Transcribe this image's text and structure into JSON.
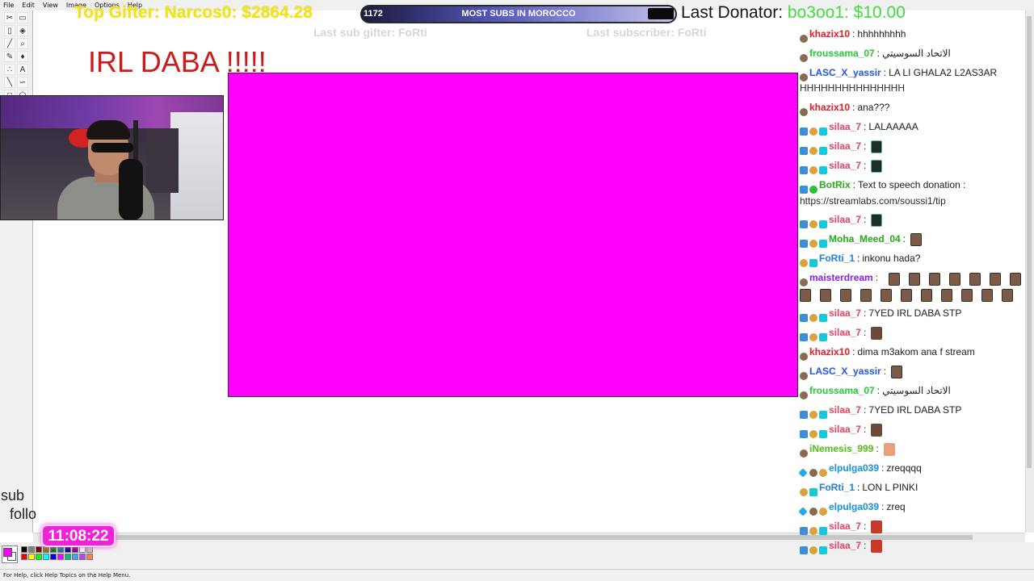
{
  "menu": {
    "items": [
      "File",
      "Edit",
      "View",
      "Image",
      "Options",
      "Help"
    ]
  },
  "overlay": {
    "top_gifter": "Top Gifter: Narcos0: $2864.28",
    "goal": {
      "count": "1172",
      "title": "MOST SUBS IN MOROCCO"
    },
    "last_donator_label": "Last Donator:",
    "last_donator_value": "bo3oo1: $10.00",
    "faded_left": "Last sub gifter: FoRti",
    "faded_right": "Last subscriber: FoRti",
    "title": "IRL DABA !!!!!",
    "sub_text": "sub",
    "follow_text": "follo",
    "clock": "11:08:22"
  },
  "colors": {
    "highlight": "#ff00ff",
    "title_red": "#cc1b1b",
    "gifter_yellow": "#f2e60a",
    "donator_green": "#3fdc3f",
    "clock_pink": "#ef22d8"
  },
  "palette": [
    "#000000",
    "#808080",
    "#800000",
    "#808000",
    "#008000",
    "#008080",
    "#000080",
    "#800080",
    "#ffffff",
    "#c0c0c0",
    "#ff0000",
    "#ffff00",
    "#00ff00",
    "#00ffff",
    "#0000ff",
    "#ff00ff",
    "#00c080",
    "#40a0ff",
    "#c040ff",
    "#ff8040"
  ],
  "chat": {
    "messages": [
      {
        "user": "khazix10",
        "color": "#e0242f",
        "text": "hhhhhhhhh",
        "badges": [
          "face"
        ]
      },
      {
        "user": "froussama_07",
        "color": "#2ecc40",
        "text": "الاتحاد السوسيتي",
        "badges": [
          "face"
        ]
      },
      {
        "user": "LASC_X_yassir",
        "color": "#2f5cd8",
        "text": "LA LI GHALA2 L2AS3AR",
        "badges": [
          "face"
        ]
      },
      {
        "user": "khazix10",
        "color": "#e0242f",
        "text": "ana???",
        "badges": [
          "face"
        ]
      },
      {
        "user": "silaa_7",
        "color": "#e34c6a",
        "text": "LALAAAAA",
        "badges": [
          "blue",
          "gold",
          "cyan"
        ]
      },
      {
        "user": "silaa_7",
        "color": "#e34c6a",
        "text": "",
        "badges": [
          "blue",
          "gold",
          "cyan"
        ],
        "emote": "dark"
      },
      {
        "user": "silaa_7",
        "color": "#e34c6a",
        "text": "",
        "badges": [
          "blue",
          "gold",
          "cyan"
        ],
        "emote": "dark"
      },
      {
        "user": "BotRix",
        "color": "#2fae20",
        "text": "Text to speech donation :",
        "badges": [
          "blue",
          "green"
        ]
      },
      {
        "user": "silaa_7",
        "color": "#e34c6a",
        "text": "",
        "badges": [
          "blue",
          "gold",
          "cyan"
        ],
        "emote": "dark"
      },
      {
        "user": "Moha_Meed_04",
        "color": "#2fae20",
        "text": "",
        "badges": [
          "blue",
          "gold",
          "cyan"
        ],
        "emote": "face"
      },
      {
        "user": "FoRti_1",
        "color": "#2b86d8",
        "text": "inkonu hada?",
        "badges": [
          "gold",
          "cyan"
        ]
      },
      {
        "user": "maisterdream",
        "color": "#8a2be2",
        "text": "",
        "badges": [
          "face"
        ]
      },
      {
        "user": "silaa_7",
        "color": "#e34c6a",
        "text": "7YED IRL DABA STP",
        "badges": [
          "blue",
          "gold",
          "cyan"
        ]
      },
      {
        "user": "silaa_7",
        "color": "#e34c6a",
        "text": "",
        "badges": [
          "blue",
          "gold",
          "cyan"
        ],
        "emote": "brown"
      },
      {
        "user": "khazix10",
        "color": "#e0242f",
        "text": "dima m3akom ana f stream",
        "badges": [
          "face"
        ]
      },
      {
        "user": "LASC_X_yassir",
        "color": "#2f5cd8",
        "text": "",
        "badges": [
          "face"
        ],
        "emote": "face"
      },
      {
        "user": "froussama_07",
        "color": "#2ecc40",
        "text": "الاتحاد السوسيتي",
        "badges": [
          "face"
        ]
      },
      {
        "user": "silaa_7",
        "color": "#e34c6a",
        "text": "7YED IRL DABA STP",
        "badges": [
          "blue",
          "gold",
          "cyan"
        ]
      },
      {
        "user": "silaa_7",
        "color": "#e34c6a",
        "text": "",
        "badges": [
          "blue",
          "gold",
          "cyan"
        ],
        "emote": "brown"
      },
      {
        "user": "iNemesis_999",
        "color": "#5cc21f",
        "text": "",
        "badges": [
          "face"
        ],
        "emote": "peach"
      },
      {
        "user": "elpulga039",
        "color": "#1e9ad6",
        "text": "zreqqqq",
        "badges": [
          "cube",
          "face",
          "gold"
        ]
      },
      {
        "user": "FoRti_1",
        "color": "#2b86d8",
        "text": "LON L PINKI",
        "badges": [
          "gold",
          "cyan"
        ]
      },
      {
        "user": "elpulga039",
        "color": "#1e9ad6",
        "text": "zreq",
        "badges": [
          "cube",
          "face",
          "gold"
        ]
      },
      {
        "user": "silaa_7",
        "color": "#e34c6a",
        "text": "",
        "badges": [
          "blue",
          "gold",
          "cyan"
        ],
        "emote": "red"
      },
      {
        "user": "silaa_7",
        "color": "#e34c6a",
        "text": "",
        "badges": [
          "blue",
          "gold",
          "cyan"
        ],
        "emote": "red"
      }
    ],
    "wrap_lines": {
      "line_2": "HHHHHHHHHHHHHHH",
      "line_7": "https://streamlabs.com/soussi1/tip"
    }
  },
  "status": {
    "text": "For Help, click Help Topics on the Help Menu."
  }
}
